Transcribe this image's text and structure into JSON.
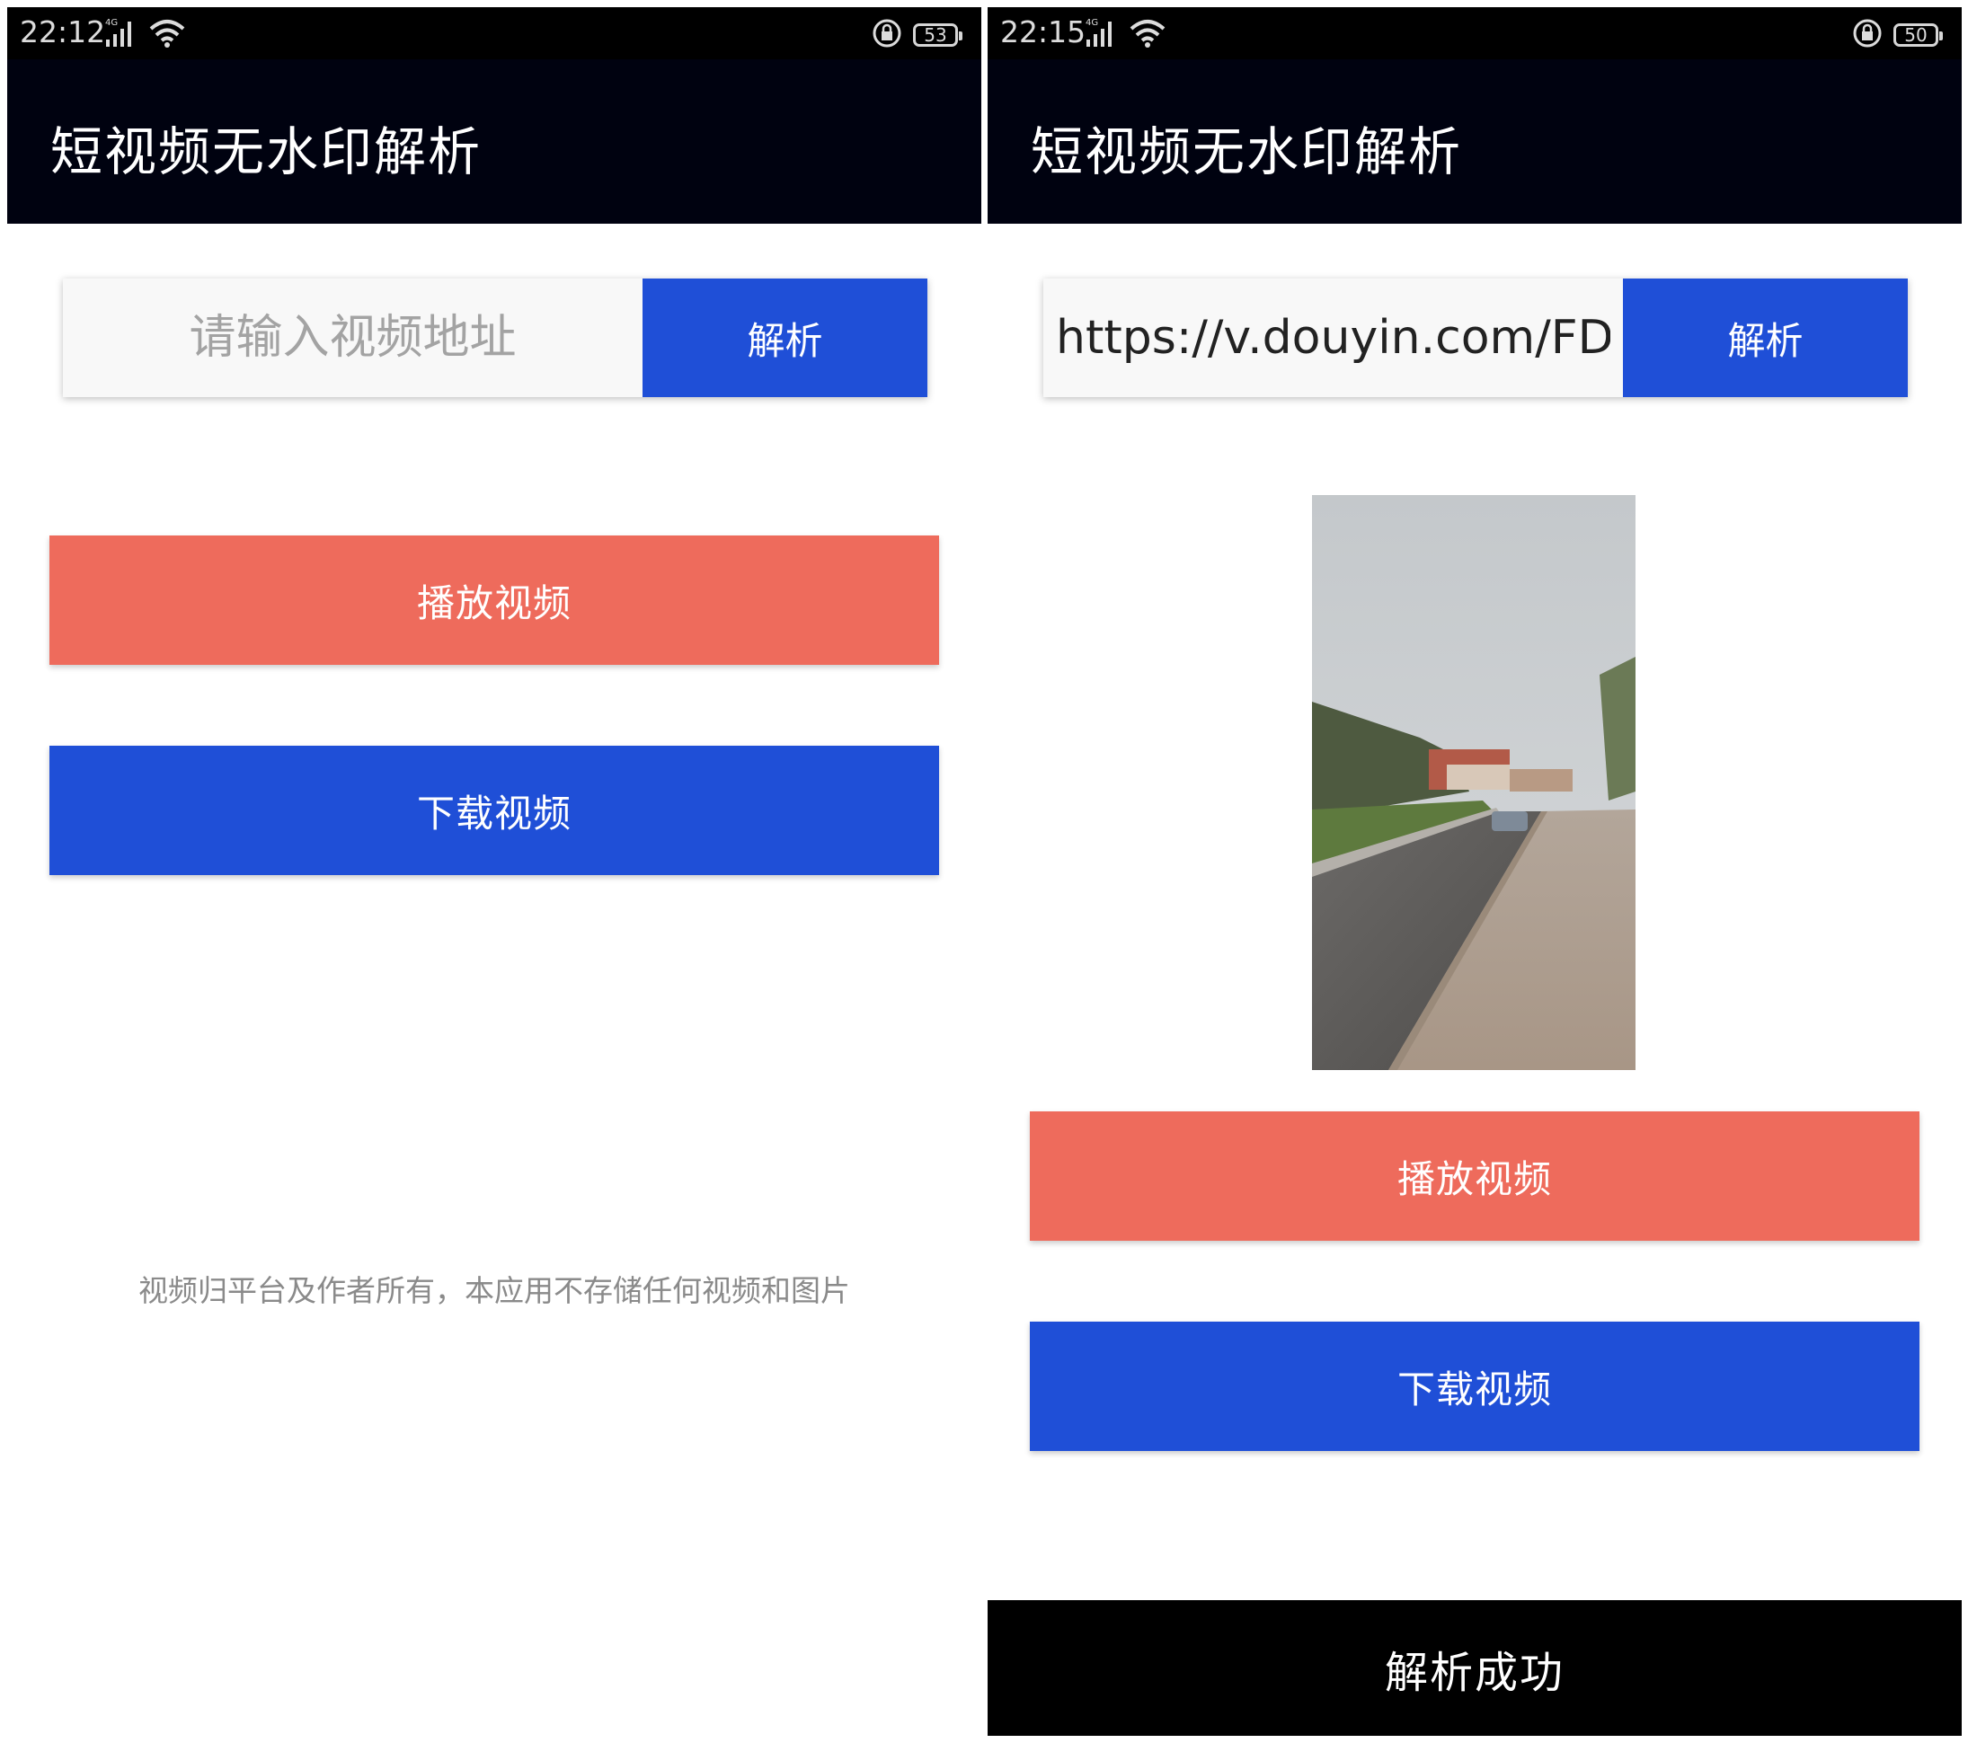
{
  "left_screen": {
    "status": {
      "time": "22:12",
      "network": "4G",
      "battery": "53"
    },
    "title": "短视频无水印解析",
    "url_input": {
      "placeholder": "请输入视频地址",
      "value": ""
    },
    "parse_label": "解析",
    "play_label": "播放视频",
    "download_label": "下载视频",
    "disclaimer": "视频归平台及作者所有，本应用不存储任何视频和图片"
  },
  "right_screen": {
    "status": {
      "time": "22:15",
      "network": "4G",
      "battery": "50"
    },
    "title": "短视频无水印解析",
    "url_input": {
      "placeholder": "请输入视频地址",
      "value": "https://v.douyin.com/FDrP"
    },
    "parse_label": "解析",
    "play_label": "播放视频",
    "download_label": "下载视频",
    "toast": "解析成功"
  },
  "colors": {
    "app_bar": "#000210",
    "primary_blue": "#1f4fd7",
    "play_red": "#ee6b5c",
    "toast_bg": "#000000"
  },
  "icons": [
    "signal-4g-icon",
    "wifi-icon",
    "rotation-lock-icon",
    "battery-icon"
  ]
}
